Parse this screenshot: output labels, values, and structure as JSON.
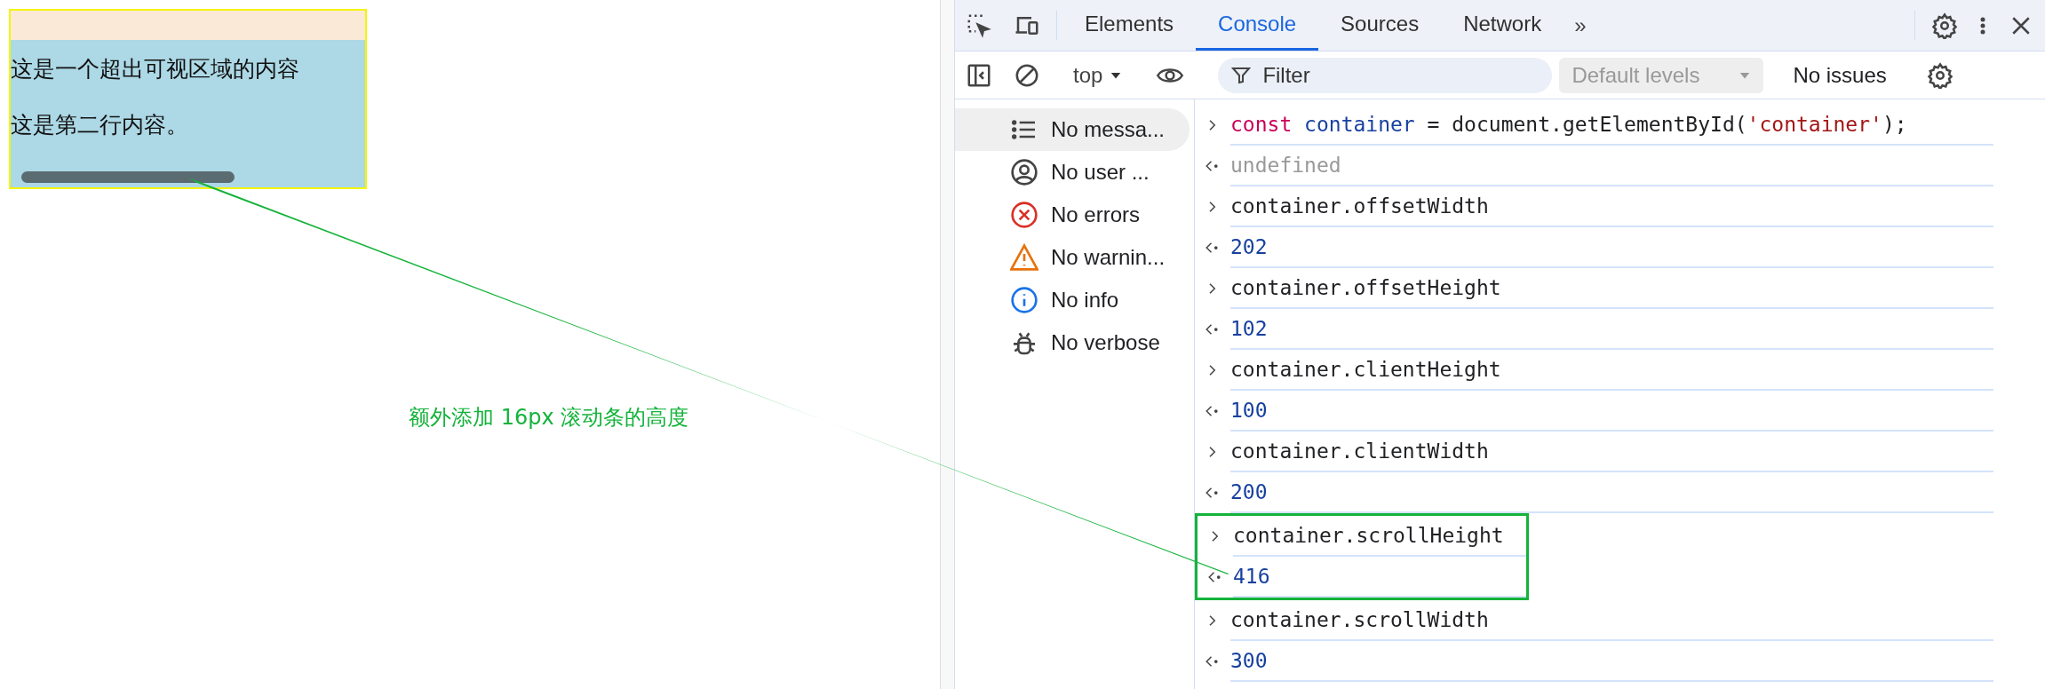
{
  "page": {
    "container": {
      "lines": [
        "这是一个超出可视区域的内容",
        "这是第二行内容。"
      ]
    },
    "annotation": {
      "text": "额外添加 16px 滚动条的高度"
    }
  },
  "devtools": {
    "tabs": [
      {
        "label": "Elements",
        "selected": false
      },
      {
        "label": "Console",
        "selected": true
      },
      {
        "label": "Sources",
        "selected": false
      },
      {
        "label": "Network",
        "selected": false
      }
    ],
    "more_tabs": "»",
    "toolbar": {
      "context": "top",
      "filter": {
        "placeholder": "Filter"
      },
      "levels": {
        "label": "Default levels",
        "disabled": true
      },
      "issues": "No issues"
    },
    "sidebar": {
      "items": [
        {
          "label": "No messa...",
          "kind": "messages",
          "selected": true
        },
        {
          "label": "No user ...",
          "kind": "user",
          "selected": false
        },
        {
          "label": "No errors",
          "kind": "error",
          "selected": false
        },
        {
          "label": "No warnin...",
          "kind": "warning",
          "selected": false
        },
        {
          "label": "No info",
          "kind": "info",
          "selected": false
        },
        {
          "label": "No verbose",
          "kind": "verbose",
          "selected": false
        }
      ]
    },
    "console": {
      "rows": [
        {
          "kind": "input",
          "annotated": false,
          "tokens": [
            {
              "kind": "keyword",
              "text": "const "
            },
            {
              "kind": "variable",
              "text": "container"
            },
            {
              "kind": "plain",
              "text": " = document.getElementById("
            },
            {
              "kind": "string",
              "text": "'container'"
            },
            {
              "kind": "plain",
              "text": ");"
            }
          ]
        },
        {
          "kind": "output",
          "annotated": false,
          "tokens": [
            {
              "kind": "undefined",
              "text": "undefined"
            }
          ]
        },
        {
          "kind": "input",
          "annotated": false,
          "tokens": [
            {
              "kind": "plain",
              "text": "container.offsetWidth"
            }
          ]
        },
        {
          "kind": "output",
          "annotated": false,
          "tokens": [
            {
              "kind": "number",
              "text": "202"
            }
          ]
        },
        {
          "kind": "input",
          "annotated": false,
          "tokens": [
            {
              "kind": "plain",
              "text": "container.offsetHeight"
            }
          ]
        },
        {
          "kind": "output",
          "annotated": false,
          "tokens": [
            {
              "kind": "number",
              "text": "102"
            }
          ]
        },
        {
          "kind": "input",
          "annotated": false,
          "tokens": [
            {
              "kind": "plain",
              "text": "container.clientHeight"
            }
          ]
        },
        {
          "kind": "output",
          "annotated": false,
          "tokens": [
            {
              "kind": "number",
              "text": "100"
            }
          ]
        },
        {
          "kind": "input",
          "annotated": false,
          "tokens": [
            {
              "kind": "plain",
              "text": "container.clientWidth"
            }
          ]
        },
        {
          "kind": "output",
          "annotated": false,
          "tokens": [
            {
              "kind": "number",
              "text": "200"
            }
          ]
        },
        {
          "kind": "input",
          "annotated": true,
          "tokens": [
            {
              "kind": "plain",
              "text": "container.scrollHeight"
            }
          ]
        },
        {
          "kind": "output",
          "annotated": true,
          "tokens": [
            {
              "kind": "number",
              "text": "416"
            }
          ]
        },
        {
          "kind": "input",
          "annotated": false,
          "tokens": [
            {
              "kind": "plain",
              "text": "container.scrollWidth"
            }
          ]
        },
        {
          "kind": "output",
          "annotated": false,
          "tokens": [
            {
              "kind": "number",
              "text": "300"
            }
          ]
        }
      ]
    }
  }
}
